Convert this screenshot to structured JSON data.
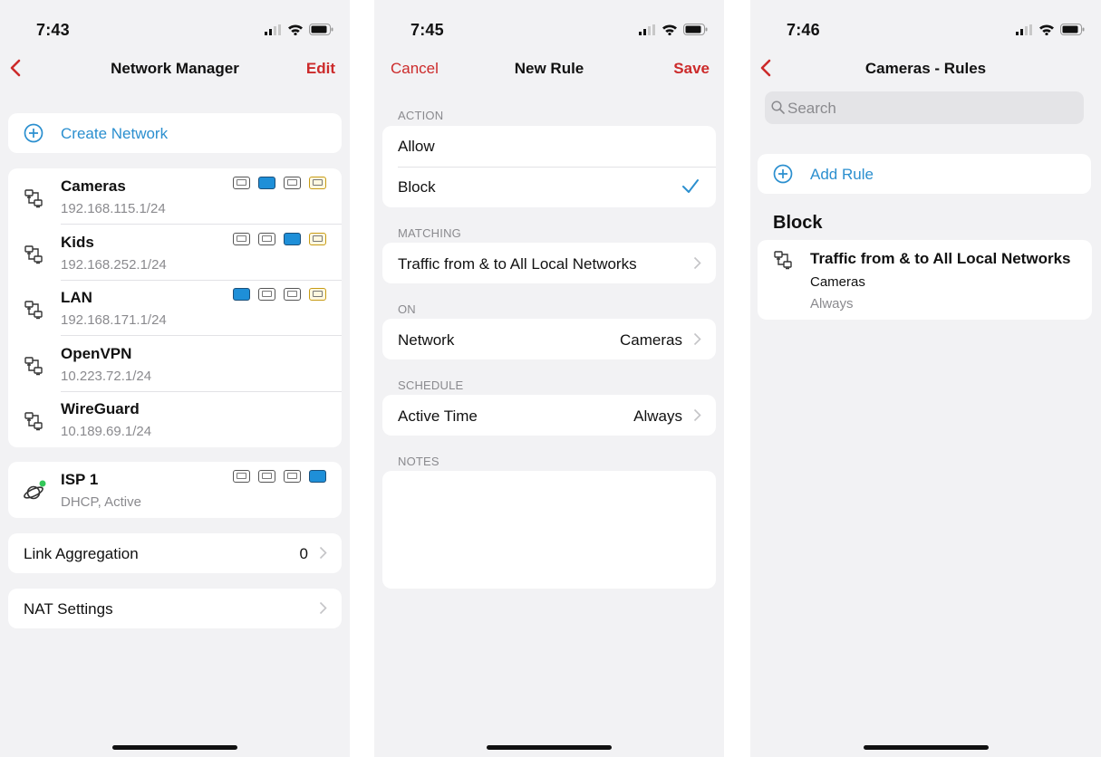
{
  "colors": {
    "accent_red": "#cc2a2a",
    "accent_blue": "#2b8fcf",
    "port_active": "#1e8fd8",
    "wan_port_border": "#c79b15",
    "online_dot": "#34c759"
  },
  "screen1": {
    "time": "7:43",
    "nav": {
      "back_icon": "chevron-left-icon",
      "title": "Network Manager",
      "edit_label": "Edit"
    },
    "create_label": "Create Network",
    "networks": [
      {
        "name": "Cameras",
        "subnet": "192.168.115.1/24",
        "ports": [
          "normal",
          "active",
          "normal",
          "wan"
        ]
      },
      {
        "name": "Kids",
        "subnet": "192.168.252.1/24",
        "ports": [
          "normal",
          "normal",
          "active",
          "wan"
        ]
      },
      {
        "name": "LAN",
        "subnet": "192.168.171.1/24",
        "ports": [
          "active",
          "normal",
          "normal",
          "wan"
        ]
      },
      {
        "name": "OpenVPN",
        "subnet": "10.223.72.1/24",
        "ports": []
      },
      {
        "name": "WireGuard",
        "subnet": "10.189.69.1/24",
        "ports": []
      }
    ],
    "isp": {
      "name": "ISP 1",
      "status": "DHCP, Active",
      "ports": [
        "normal",
        "normal",
        "normal",
        "active"
      ]
    },
    "link_aggregation": {
      "label": "Link Aggregation",
      "value": "0"
    },
    "nat_settings": {
      "label": "NAT Settings"
    }
  },
  "screen2": {
    "time": "7:45",
    "nav": {
      "cancel_label": "Cancel",
      "title": "New Rule",
      "save_label": "Save"
    },
    "action_header": "ACTION",
    "action_options": [
      "Allow",
      "Block"
    ],
    "selected_action": "Block",
    "matching_header": "MATCHING",
    "matching_value": "Traffic from & to All Local Networks",
    "on_header": "ON",
    "network_label": "Network",
    "network_value": "Cameras",
    "schedule_header": "SCHEDULE",
    "active_time_label": "Active Time",
    "active_time_value": "Always",
    "notes_header": "NOTES"
  },
  "screen3": {
    "time": "7:46",
    "nav": {
      "back_icon": "chevron-left-icon",
      "title": "Cameras - Rules"
    },
    "search_placeholder": "Search",
    "add_rule_label": "Add Rule",
    "section_title": "Block",
    "rule": {
      "title": "Traffic from & to All Local Networks",
      "network": "Cameras",
      "schedule": "Always"
    }
  }
}
